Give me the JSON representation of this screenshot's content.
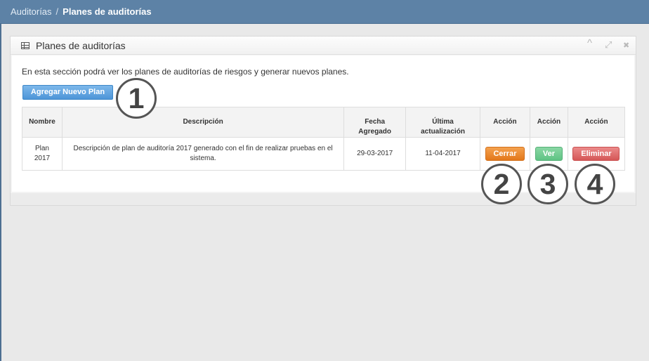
{
  "breadcrumb": {
    "parent": "Auditorías",
    "separator": "/",
    "current": "Planes de auditorías"
  },
  "widget": {
    "title": "Planes de auditorías",
    "intro": "En esta sección podrá ver los planes de auditorías de riesgos y generar nuevos planes.",
    "add_button": "Agregar Nuevo Plan",
    "controls": {
      "collapse": "^",
      "fullscreen": "⤢",
      "close": "✖"
    }
  },
  "table": {
    "headers": {
      "nombre": "Nombre",
      "descripcion": "Descripción",
      "fecha_line1": "Fecha",
      "fecha_line2": "Agregado",
      "ultima_line1": "Última",
      "ultima_line2": "actualización",
      "accion1": "Acción",
      "accion2": "Acción",
      "accion3": "Acción"
    },
    "rows": [
      {
        "nombre_line1": "Plan",
        "nombre_line2": "2017",
        "descripcion": "Descripción de plan de auditoría 2017 generado con el fin de realizar pruebas en el sistema.",
        "fecha": "29-03-2017",
        "ultima": "11-04-2017",
        "btn_cerrar": "Cerrar",
        "btn_ver": "Ver",
        "btn_eliminar": "Eliminar"
      }
    ]
  },
  "callouts": [
    "1",
    "2",
    "3",
    "4"
  ]
}
